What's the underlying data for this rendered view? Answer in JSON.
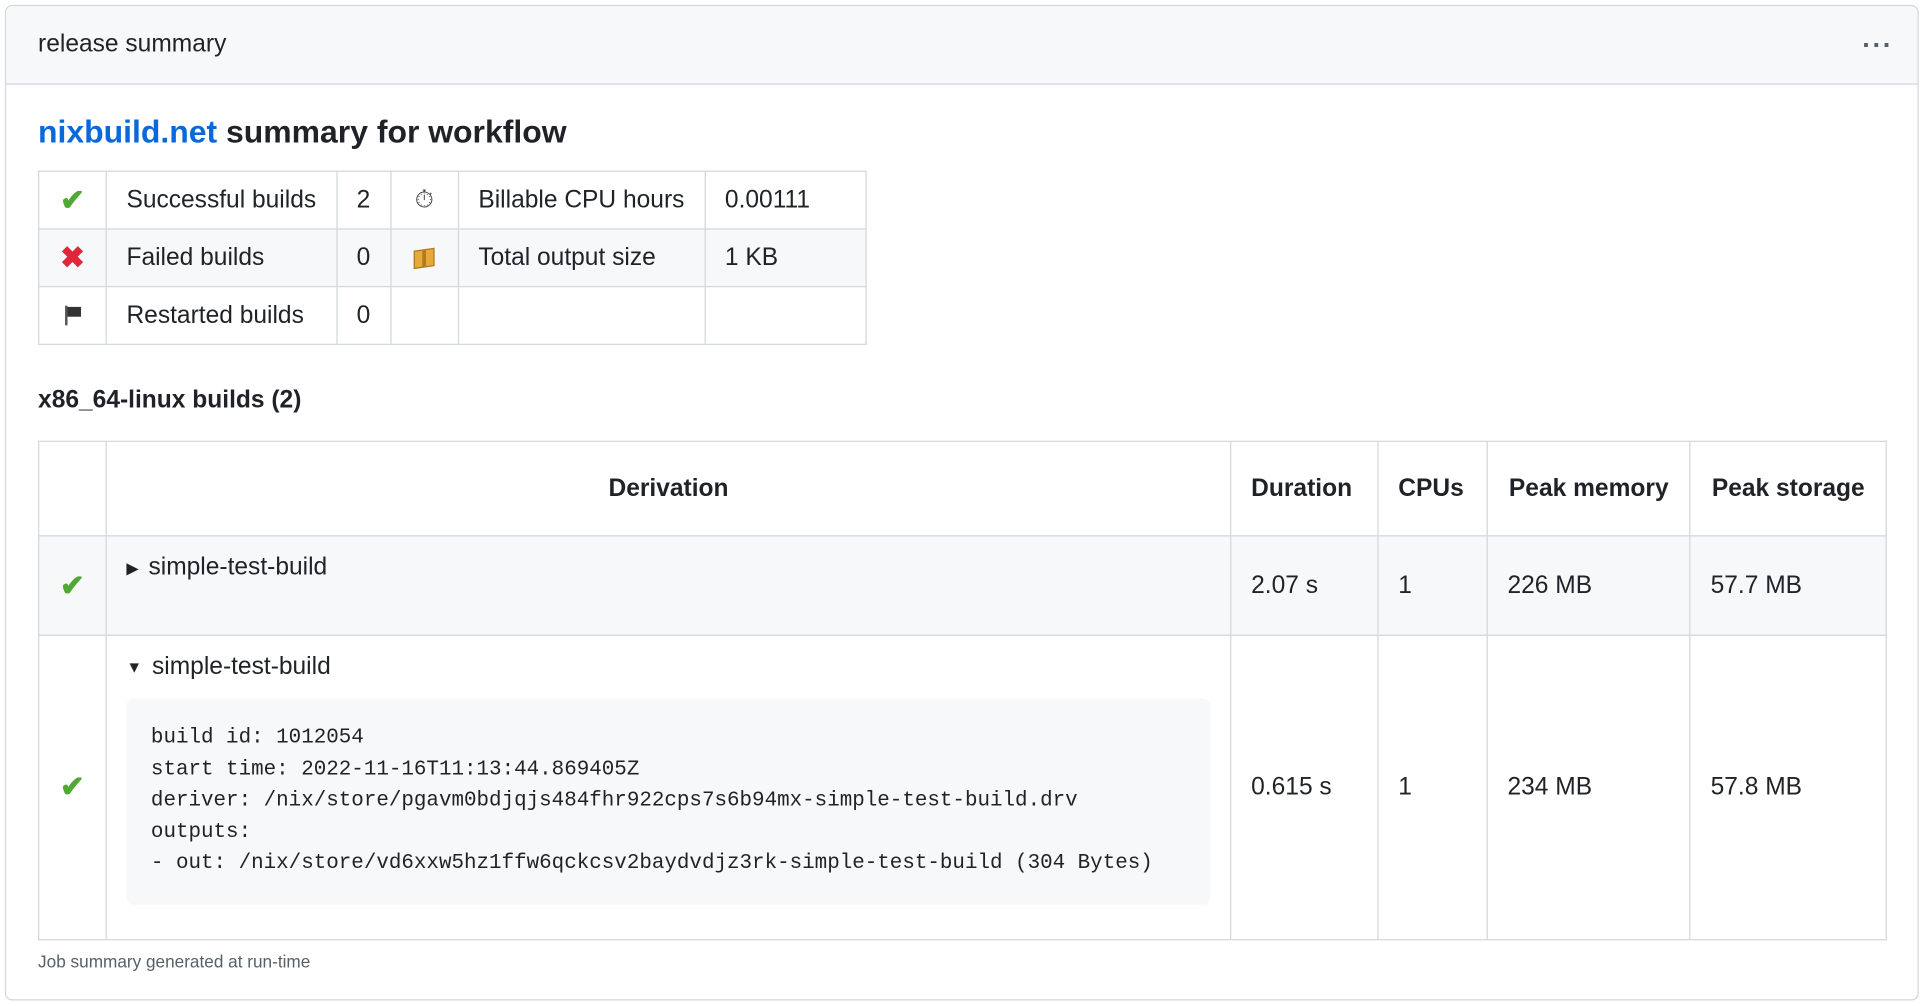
{
  "card": {
    "title": "release summary",
    "menu_label": "···"
  },
  "heading": {
    "link": "nixbuild.net",
    "rest": " summary for workflow"
  },
  "summary": {
    "rows": [
      {
        "label": "Successful builds",
        "value": "2",
        "metric_label": "Billable CPU hours",
        "metric_value": "0.00111"
      },
      {
        "label": "Failed builds",
        "value": "0",
        "metric_label": "Total output size",
        "metric_value": "1 KB"
      },
      {
        "label": "Restarted builds",
        "value": "0",
        "metric_label": "",
        "metric_value": ""
      }
    ]
  },
  "builds": {
    "title": "x86_64-linux builds (2)",
    "headers": {
      "derivation": "Derivation",
      "duration": "Duration",
      "cpus": "CPUs",
      "peak_memory": "Peak memory",
      "peak_storage": "Peak storage"
    },
    "rows": [
      {
        "name": "simple-test-build",
        "expanded": false,
        "duration": "2.07 s",
        "cpus": "1",
        "peak_memory": "226 MB",
        "peak_storage": "57.7 MB"
      },
      {
        "name": "simple-test-build",
        "expanded": true,
        "duration": "0.615 s",
        "cpus": "1",
        "peak_memory": "234 MB",
        "peak_storage": "57.8 MB",
        "details": "build id: 1012054\nstart time: 2022-11-16T11:13:44.869405Z\nderiver: /nix/store/pgavm0bdjqjs484fhr922cps7s6b94mx-simple-test-build.drv\noutputs:\n- out: /nix/store/vd6xxw5hz1ffw6qckcsv2baydvdjz3rk-simple-test-build (304 Bytes)"
      }
    ]
  },
  "footer": "Job summary generated at run-time",
  "icons": {
    "success": "check-icon",
    "failed": "cross-icon",
    "restarted": "flag-icon",
    "cpu_hours": "stopwatch-icon",
    "output_size": "package-icon",
    "collapsed": "triangle-right-icon",
    "expanded": "triangle-down-icon"
  },
  "colors": {
    "link": "#0969da",
    "success": "#52a834",
    "failed": "#e0263a",
    "header_bg": "#f6f8fa",
    "border": "#d0d7de"
  }
}
